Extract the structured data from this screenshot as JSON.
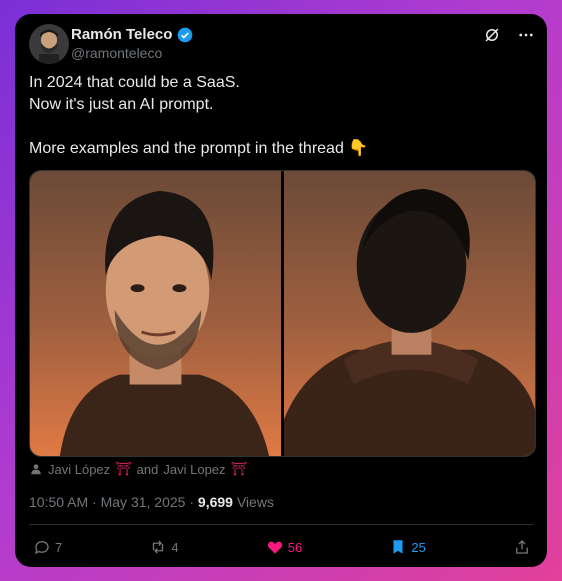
{
  "author": {
    "name": "Ramón Teleco",
    "handle": "@ramonteleco"
  },
  "icons": [
    "verified-badge-icon",
    "grok-icon",
    "more-icon",
    "person-icon",
    "torii-icon",
    "reply-icon",
    "retweet-icon",
    "heart-icon",
    "bookmark-icon",
    "share-icon"
  ],
  "post": {
    "lines": [
      "In 2024 that could be a SaaS.",
      "Now it's just an AI prompt.",
      "",
      "More examples and the prompt in the thread 👇"
    ]
  },
  "tags": {
    "person1": "Javi López",
    "torii1": "⛩",
    "and_text": "and",
    "person2": "Javi Lopez",
    "torii2": "⛩"
  },
  "meta": {
    "time": "10:50 AM",
    "date": "May 31, 2025",
    "views_count": "9,699",
    "views_label": "Views"
  },
  "actions": {
    "replies": "7",
    "reposts": "4",
    "likes": "56",
    "bookmarks": "25"
  },
  "colors": {
    "like": "#f91880",
    "bookmark": "#1d9bf0",
    "verified": "#1d9bf0",
    "torii": "#e0245e",
    "muted": "#71767b"
  }
}
